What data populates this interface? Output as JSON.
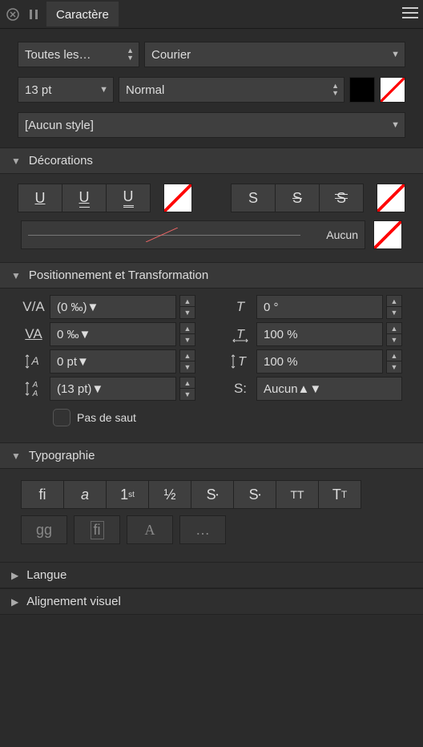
{
  "header": {
    "tab_title": "Caractère"
  },
  "top": {
    "font_family_group": "Toutes les…",
    "font_family": "Courier",
    "font_size": "13 pt",
    "font_style": "Normal",
    "char_style": "[Aucun style]"
  },
  "sections": {
    "decorations": "Décorations",
    "positioning": "Positionnement et Transformation",
    "typography": "Typographie",
    "language": "Langue",
    "optical": "Alignement visuel"
  },
  "decor": {
    "u1": "U",
    "u2": "U",
    "u3": "U",
    "s1": "S",
    "s2": "S",
    "s3": "S",
    "strike_label": "Aucun"
  },
  "pos": {
    "kerning": "(0 ‰)",
    "tracking": "0 ‰",
    "baseline": "0 pt",
    "leading": "(13 pt)",
    "shear": "0 °",
    "hscale": "100 %",
    "vscale": "100 %",
    "style_select": "Aucun",
    "no_break": "Pas de saut"
  },
  "typo": {
    "ligatures": "fi",
    "swash": "a",
    "ordinal": "1",
    "ordinal_sup": "st",
    "fraction": "½",
    "s_dot1": "S",
    "s_dot2": "S",
    "allcaps": "TT",
    "smallcaps_t": "T",
    "smallcaps_small": "T",
    "discretionary": "gg",
    "hist": "fi",
    "stylistic": "A",
    "more": "…"
  }
}
